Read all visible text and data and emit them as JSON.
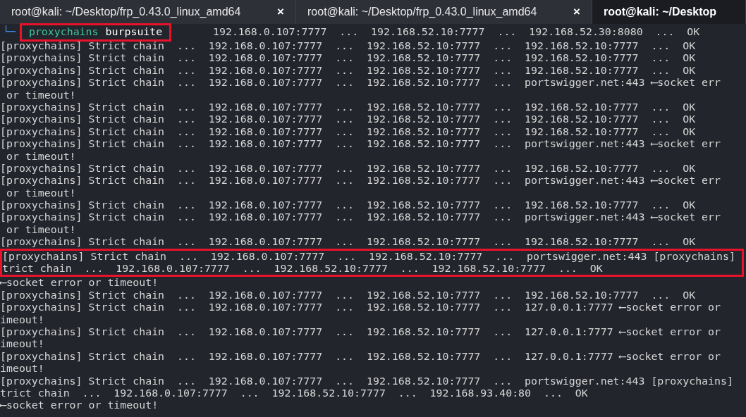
{
  "tabs": [
    {
      "title": "root@kali: ~/Desktop/frp_0.43.0_linux_amd64",
      "close": "×",
      "selected": false
    },
    {
      "title": "root@kali: ~/Desktop/frp_0.43.0_linux_amd64",
      "close": "×",
      "selected": false
    },
    {
      "title": "root@kali: ~/Desktop",
      "selected": true
    }
  ],
  "prompt": {
    "symbol": "└─",
    "program": "proxychains",
    "argument": "burpsuite",
    "highlighted": true,
    "output": "192.168.0.107:7777  ...  192.168.52.10:7777  ...  192.168.52.30:8080  ...  OK"
  },
  "groups": [
    {
      "highlighted": false,
      "lines": [
        "[proxychains] Strict chain  ...  192.168.0.107:7777  ...  192.168.52.10:7777  ...  192.168.52.10:7777  ...  OK",
        "[proxychains] Strict chain  ...  192.168.0.107:7777  ...  192.168.52.10:7777  ...  192.168.52.10:7777  ...  OK",
        "[proxychains] Strict chain  ...  192.168.0.107:7777  ...  192.168.52.10:7777  ...  192.168.52.10:7777  ...  OK",
        "[proxychains] Strict chain  ...  192.168.0.107:7777  ...  192.168.52.10:7777  ...  portswigger.net:443 ⟵socket err",
        " or timeout!",
        "[proxychains] Strict chain  ...  192.168.0.107:7777  ...  192.168.52.10:7777  ...  192.168.52.10:7777  ...  OK",
        "[proxychains] Strict chain  ...  192.168.0.107:7777  ...  192.168.52.10:7777  ...  192.168.52.10:7777  ...  OK",
        "[proxychains] Strict chain  ...  192.168.0.107:7777  ...  192.168.52.10:7777  ...  192.168.52.10:7777  ...  OK",
        "[proxychains] Strict chain  ...  192.168.0.107:7777  ...  192.168.52.10:7777  ...  portswigger.net:443 ⟵socket err",
        " or timeout!",
        "[proxychains] Strict chain  ...  192.168.0.107:7777  ...  192.168.52.10:7777  ...  192.168.52.10:7777  ...  OK",
        "[proxychains] Strict chain  ...  192.168.0.107:7777  ...  192.168.52.10:7777  ...  portswigger.net:443 ⟵socket err",
        " or timeout!",
        "[proxychains] Strict chain  ...  192.168.0.107:7777  ...  192.168.52.10:7777  ...  192.168.52.10:7777  ...  OK",
        "[proxychains] Strict chain  ...  192.168.0.107:7777  ...  192.168.52.10:7777  ...  portswigger.net:443 ⟵socket err",
        " or timeout!",
        "[proxychains] Strict chain  ...  192.168.0.107:7777  ...  192.168.52.10:7777  ...  192.168.52.10:7777  ...  OK"
      ]
    },
    {
      "highlighted": true,
      "lines": [
        "[proxychains] Strict chain  ...  192.168.0.107:7777  ...  192.168.52.10:7777  ...  portswigger.net:443 [proxychains]",
        "trict chain  ...  192.168.0.107:7777  ...  192.168.52.10:7777  ...  192.168.52.10:7777  ...  OK"
      ]
    },
    {
      "highlighted": false,
      "lines": [
        "⟵socket error or timeout!",
        "[proxychains] Strict chain  ...  192.168.0.107:7777  ...  192.168.52.10:7777  ...  192.168.52.10:7777  ...  OK",
        "[proxychains] Strict chain  ...  192.168.0.107:7777  ...  192.168.52.10:7777  ...  127.0.0.1:7777 ⟵socket error or",
        "imeout!",
        "[proxychains] Strict chain  ...  192.168.0.107:7777  ...  192.168.52.10:7777  ...  127.0.0.1:7777 ⟵socket error or",
        "imeout!",
        "[proxychains] Strict chain  ...  192.168.0.107:7777  ...  192.168.52.10:7777  ...  127.0.0.1:7777 ⟵socket error or",
        "imeout!",
        "[proxychains] Strict chain  ...  192.168.0.107:7777  ...  192.168.52.10:7777  ...  portswigger.net:443 [proxychains]",
        "trict chain  ...  192.168.0.107:7777  ...  192.168.52.10:7777  ...  192.168.93.40:80  ...  OK",
        "⟵socket error or timeout!"
      ]
    }
  ]
}
